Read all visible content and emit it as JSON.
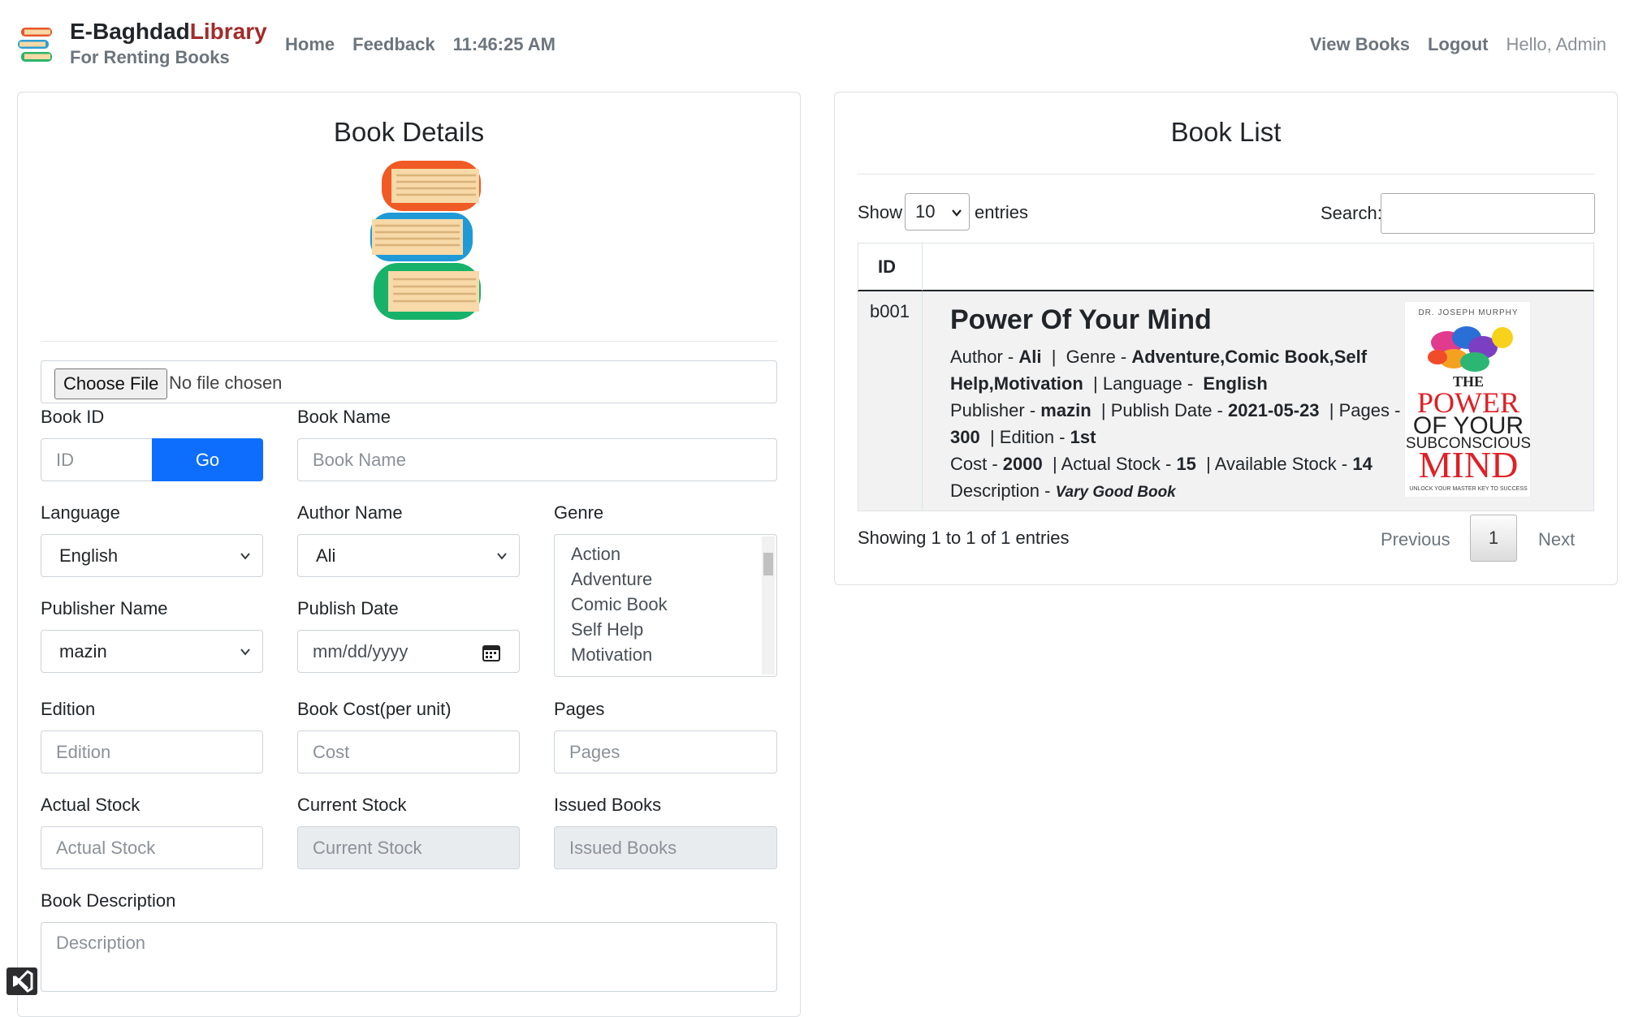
{
  "brand": {
    "name_main": "E-Baghdad",
    "name_accent": "Library",
    "tagline": "For Renting Books"
  },
  "nav": {
    "home": "Home",
    "feedback": "Feedback",
    "clock": "11:46:25 AM",
    "view_books": "View Books",
    "logout": "Logout",
    "greeting": "Hello, Admin"
  },
  "details": {
    "title": "Book Details",
    "file": {
      "button": "Choose File",
      "status": "No file chosen"
    },
    "book_id": {
      "label": "Book ID",
      "placeholder": "ID",
      "go": "Go"
    },
    "book_name": {
      "label": "Book Name",
      "placeholder": "Book Name"
    },
    "language": {
      "label": "Language",
      "value": "English"
    },
    "author": {
      "label": "Author Name",
      "value": "Ali"
    },
    "genre": {
      "label": "Genre",
      "options": [
        "Action",
        "Adventure",
        "Comic Book",
        "Self Help",
        "Motivation"
      ]
    },
    "publisher": {
      "label": "Publisher Name",
      "value": "mazin"
    },
    "publish_date": {
      "label": "Publish Date",
      "placeholder": "mm/dd/yyyy"
    },
    "edition": {
      "label": "Edition",
      "placeholder": "Edition"
    },
    "cost": {
      "label": "Book Cost(per unit)",
      "placeholder": "Cost"
    },
    "pages": {
      "label": "Pages",
      "placeholder": "Pages"
    },
    "actual_stock": {
      "label": "Actual Stock",
      "placeholder": "Actual Stock"
    },
    "current_stock": {
      "label": "Current Stock",
      "placeholder": "Current Stock"
    },
    "issued_books": {
      "label": "Issued Books",
      "placeholder": "Issued Books"
    },
    "description": {
      "label": "Book Description",
      "placeholder": "Description"
    }
  },
  "list": {
    "title": "Book List",
    "show": "Show",
    "entries_value": "10",
    "entries": "entries",
    "search_label": "Search:",
    "col_id": "ID",
    "rows": [
      {
        "id": "b001",
        "title": "Power Of Your Mind",
        "author_label": "Author - ",
        "author": "Ali",
        "genre_label": "Genre - ",
        "genre": "Adventure,Comic Book,Self Help,Motivation",
        "language_label": "Language - ",
        "language": "English",
        "publisher_label": "Publisher - ",
        "publisher": "mazin",
        "date_label": "Publish Date - ",
        "date": "2021-05-23",
        "pages_label": "Pages - ",
        "pages": "300",
        "edition_label": "Edition - ",
        "edition": "1st",
        "cost_label": "Cost - ",
        "cost": "2000",
        "actual_label": "Actual Stock - ",
        "actual": "15",
        "available_label": "Available Stock - ",
        "available": "14",
        "desc_label": "Description - ",
        "desc": "Vary Good Book",
        "cover": {
          "top": "DR. JOSEPH MURPHY",
          "the": "THE",
          "power": "POWER",
          "of_your": "OF YOUR",
          "subconscious": "SUBCONSCIOUS",
          "mind": "MIND",
          "foot": "UNLOCK YOUR MASTER KEY TO SUCCESS"
        }
      }
    ],
    "info": "Showing 1 to 1 of 1 entries",
    "prev": "Previous",
    "page": "1",
    "next": "Next"
  }
}
